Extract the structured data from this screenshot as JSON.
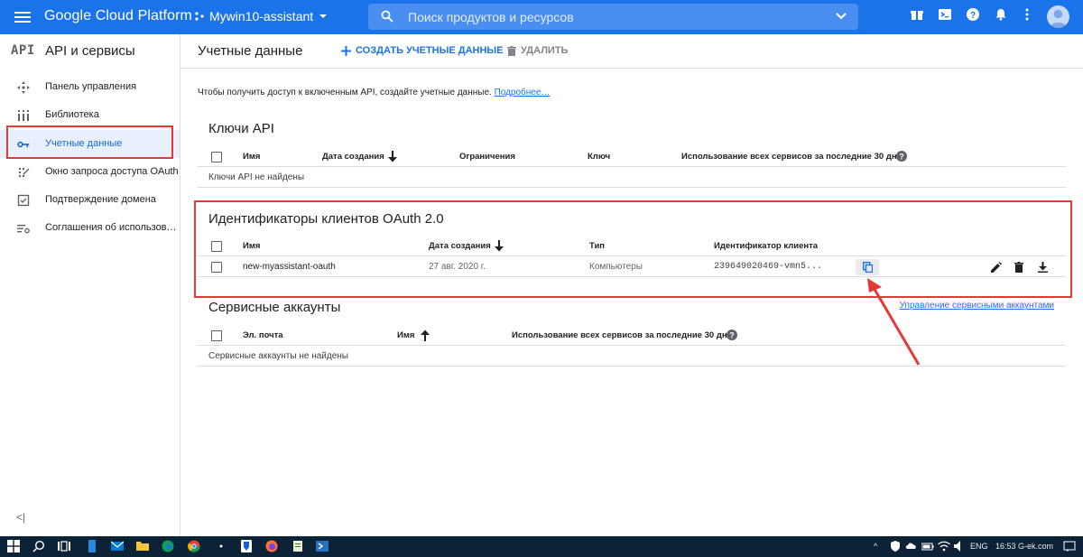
{
  "topbar": {
    "brand": "Google Cloud Platform",
    "project": "Mywin10-assistant",
    "search_placeholder": "Поиск продуктов и ресурсов"
  },
  "sidebar": {
    "logo": "API",
    "title": "API и сервисы",
    "items": [
      {
        "label": "Панель управления",
        "icon": "dashboard-icon"
      },
      {
        "label": "Библиотека",
        "icon": "library-icon"
      },
      {
        "label": "Учетные данные",
        "icon": "key-icon",
        "active": true
      },
      {
        "label": "Окно запроса доступа OAuth",
        "icon": "consent-icon"
      },
      {
        "label": "Подтверждение домена",
        "icon": "checkbox-icon"
      },
      {
        "label": "Соглашения об использов…",
        "icon": "settings-list-icon"
      }
    ],
    "collapse": "<|"
  },
  "header": {
    "title": "Учетные данные",
    "create_label": "СОЗДАТЬ УЧЕТНЫЕ ДАННЫЕ",
    "delete_label": "УДАЛИТЬ"
  },
  "intro": {
    "text": "Чтобы получить доступ к включенным API, создайте учетные данные.",
    "link": "Подробнее…"
  },
  "api_keys": {
    "title": "Ключи API",
    "columns": [
      "Имя",
      "Дата создания",
      "Ограничения",
      "Ключ",
      "Использование всех сервисов за последние 30 дней"
    ],
    "empty": "Ключи API не найдены"
  },
  "oauth": {
    "title": "Идентификаторы клиентов OAuth 2.0",
    "columns": [
      "Имя",
      "Дата создания",
      "Тип",
      "Идентификатор клиента"
    ],
    "row": {
      "name": "new-myassistant-oauth",
      "date": "27 авг. 2020 г.",
      "type": "Компьютеры",
      "client_id": "239649020469-vmn5..."
    }
  },
  "service_accounts": {
    "title": "Сервисные аккаунты",
    "manage_link": "Управление сервисными аккаунтами",
    "columns": [
      "Эл. почта",
      "Имя",
      "Использование всех сервисов за последние 30 дней"
    ],
    "empty": "Сервисные аккаунты не найдены"
  },
  "taskbar": {
    "lang": "ENG",
    "clock": "16:53 G-ek.com"
  },
  "colors": {
    "accent": "#1a73e8",
    "annotation_red": "#e53935",
    "taskbar": "#0c2236"
  }
}
